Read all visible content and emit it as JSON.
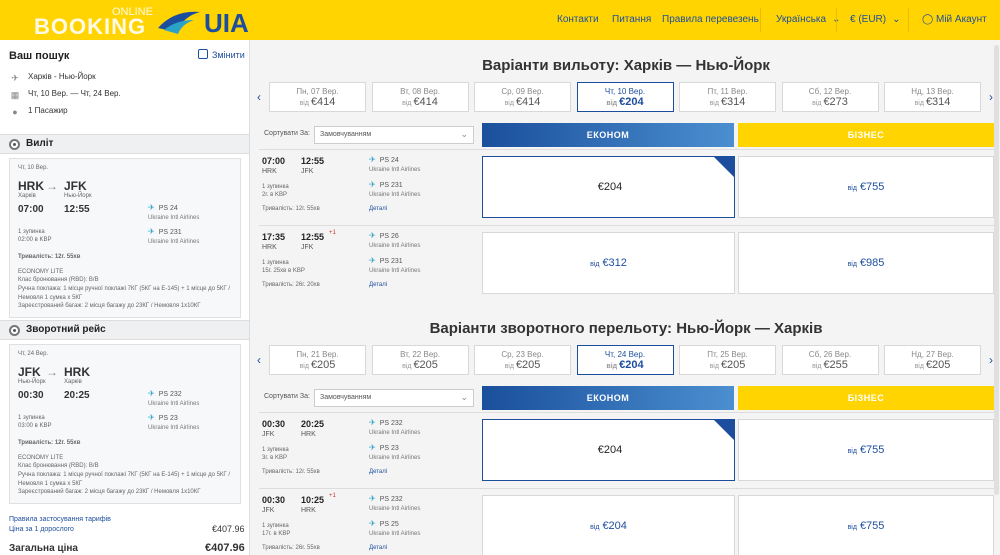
{
  "brand": {
    "booking": "BOOKING",
    "online": "ONLINE",
    "uia": "UIA"
  },
  "nav": {
    "contacts": "Контакти",
    "meals": "Питання",
    "rules": "Правила перевезень",
    "language": "Українська",
    "currency": "€ (EUR)",
    "account": "Мій Акаунт"
  },
  "sidebar": {
    "title": "Ваш пошук",
    "edit": "Змінити",
    "route": "Харків - Нью-Йорк",
    "dates": "Чт, 10 Вер. — Чт, 24 Вер.",
    "pax": "1 Пасажир",
    "out_title": "Виліт",
    "out": {
      "date": "Чт, 10 Вер.",
      "from": "HRK",
      "to": "JFK",
      "from_city": "Харків",
      "to_city": "Нью-Йорк",
      "dep": "07:00",
      "arr": "12:55",
      "stops": "1 зупинка",
      "stop_info": "02:00 в KBP",
      "f1": "PS 24",
      "f2": "PS 231",
      "airline": "Ukraine Intl Airlines",
      "duration": "Тривалість: 12г. 55хв",
      "fare": "ECONOMY LITE",
      "rbd": "Клас бронювання (RBD): B/B",
      "hand": "Ручна поклажа: 1 місце ручної поклажі 7КГ (5КГ на Е-145) + 1 місце до 5КГ / Немовля 1 сумка х 5КГ",
      "bag": "Зареєстрований багаж: 2 місця багажу до 23КГ / Немовля 1х10КГ"
    },
    "ret_title": "Зворотний рейс",
    "ret": {
      "date": "Чт, 24 Вер.",
      "from": "JFK",
      "to": "HRK",
      "from_city": "Нью-Йорк",
      "to_city": "Харків",
      "dep": "00:30",
      "arr": "20:25",
      "stops": "1 зупинка",
      "stop_info": "03:00 в KBP",
      "f1": "PS 232",
      "f2": "PS 23",
      "airline": "Ukraine Intl Airlines",
      "duration": "Тривалість: 12г. 55хв",
      "fare": "ECONOMY LITE",
      "rbd": "Клас бронювання (RBD): B/B",
      "hand": "Ручна поклажа: 1 місце ручної поклажі 7КГ (5КГ на Е-145) + 1 місце до 5КГ / Немовля 1 сумка х 5КГ",
      "bag": "Зареєстрований багаж: 2 місця багажу до 23КГ / Немовля 1х10КГ"
    },
    "fare_rules": "Правила застосування тарифів",
    "per_adult": "Ціна за 1 дорослого",
    "per_adult_price": "€407.96",
    "total_label": "Загальна ціна",
    "total": "€407.96"
  },
  "outbound": {
    "title": "Варіанти вильоту: Харків — Нью-Йорк",
    "from": "від",
    "dates": [
      {
        "d": "Пн, 07 Вер.",
        "p": "€414"
      },
      {
        "d": "Вт, 08 Вер.",
        "p": "€414"
      },
      {
        "d": "Ср, 09 Вер.",
        "p": "€414"
      },
      {
        "d": "Чт, 10 Вер.",
        "p": "€204"
      },
      {
        "d": "Пт, 11 Вер.",
        "p": "€314"
      },
      {
        "d": "Сб, 12 Вер.",
        "p": "€273"
      },
      {
        "d": "Нд, 13 Вер.",
        "p": "€314"
      }
    ],
    "sort_label": "Сортувати За:",
    "sort_value": "Замовчуванням",
    "economy": "ЕКОНОМ",
    "business": "БІЗНЕС",
    "flights": [
      {
        "dep": "07:00",
        "arr": "12:55",
        "plus": "",
        "from": "HRK",
        "to": "JFK",
        "stops": "1 зупинка",
        "stop_info": "2г. в KBP",
        "duration": "Тривалість: 12г. 55хв",
        "f1": "PS 24",
        "f2": "PS 231",
        "airline": "Ukraine Intl Airlines",
        "details": "Деталі",
        "eco_from": "",
        "eco": "€204",
        "biz_from": "від",
        "biz": "€755"
      },
      {
        "dep": "17:35",
        "arr": "12:55",
        "plus": "+1",
        "from": "HRK",
        "to": "JFK",
        "stops": "1 зупинка",
        "stop_info": "15г. 25хв в KBP",
        "duration": "Тривалість: 26г. 20хв",
        "f1": "PS 26",
        "f2": "PS 231",
        "airline": "Ukraine Intl Airlines",
        "details": "Деталі",
        "eco_from": "від",
        "eco": "€312",
        "biz_from": "від",
        "biz": "€985"
      }
    ]
  },
  "return": {
    "title": "Варіанти зворотного перельоту: Нью-Йорк — Харків",
    "from": "від",
    "dates": [
      {
        "d": "Пн, 21 Вер.",
        "p": "€205"
      },
      {
        "d": "Вт, 22 Вер.",
        "p": "€205"
      },
      {
        "d": "Ср, 23 Вер.",
        "p": "€205"
      },
      {
        "d": "Чт, 24 Вер.",
        "p": "€204"
      },
      {
        "d": "Пт, 25 Вер.",
        "p": "€205"
      },
      {
        "d": "Сб, 26 Вер.",
        "p": "€255"
      },
      {
        "d": "Нд, 27 Вер.",
        "p": "€205"
      }
    ],
    "sort_label": "Сортувати За:",
    "sort_value": "Замовчуванням",
    "economy": "ЕКОНОМ",
    "business": "БІЗНЕС",
    "flights": [
      {
        "dep": "00:30",
        "arr": "20:25",
        "plus": "",
        "from": "JFK",
        "to": "HRK",
        "stops": "1 зупинка",
        "stop_info": "3г. в KBP",
        "duration": "Тривалість: 12г. 55хв",
        "f1": "PS 232",
        "f2": "PS 23",
        "airline": "Ukraine Intl Airlines",
        "details": "Деталі",
        "eco_from": "",
        "eco": "€204",
        "biz_from": "від",
        "biz": "€755"
      },
      {
        "dep": "00:30",
        "arr": "10:25",
        "plus": "+1",
        "from": "JFK",
        "to": "HRK",
        "stops": "1 зупинка",
        "stop_info": "17г. в KBP",
        "duration": "Тривалість: 26г. 55хв",
        "f1": "PS 232",
        "f2": "PS 25",
        "airline": "Ukraine Intl Airlines",
        "details": "Деталі",
        "eco_from": "від",
        "eco": "€204",
        "biz_from": "від",
        "biz": "€755"
      }
    ]
  }
}
